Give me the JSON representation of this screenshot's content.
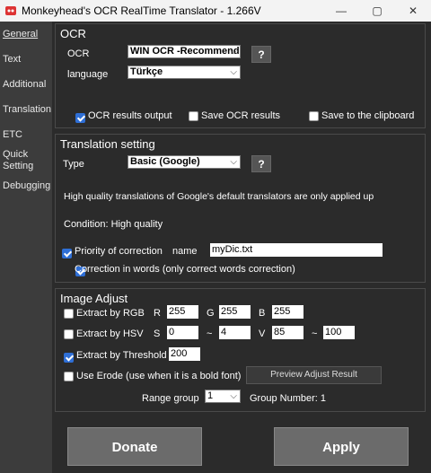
{
  "window": {
    "title": "Monkeyhead's OCR RealTime Translator - 1.266V",
    "minimize": "—",
    "maximize": "▢",
    "close": "✕"
  },
  "sidebar": {
    "items": [
      {
        "label": "General"
      },
      {
        "label": "Text"
      },
      {
        "label": "Additional"
      },
      {
        "label": "Translation"
      },
      {
        "label": "ETC"
      },
      {
        "label": "Quick Setting"
      },
      {
        "label": "Debugging"
      }
    ]
  },
  "ocr": {
    "heading": "OCR",
    "ocr_label": "OCR",
    "ocr_value": "WIN OCR -Recommend",
    "language_label": "language",
    "language_value": "Türkçe",
    "help": "?",
    "results_output": "OCR results output",
    "save_results": "Save OCR results",
    "save_clipboard": "Save to the clipboard"
  },
  "translation": {
    "heading": "Translation setting",
    "type_label": "Type",
    "type_value": "Basic (Google)",
    "help": "?",
    "info": "High quality translations of Google's default translators are only applied up",
    "condition": "Condition: High quality",
    "priority_label": "Priority of correction",
    "name_label": "name",
    "name_value": "myDic.txt",
    "words_label": "Correction in words (only correct words correction)"
  },
  "image": {
    "heading": "Image Adjust",
    "rgb_label": "Extract by RGB",
    "r_label": "R",
    "r_value": "255",
    "g_label": "G",
    "g_value": "255",
    "b_label": "B",
    "b_value": "255",
    "hsv_label": "Extract by HSV",
    "s_label": "S",
    "s_min": "0",
    "tilde": "~",
    "s_max": "4",
    "v_label": "V",
    "v_min": "85",
    "v_max": "100",
    "threshold_label": "Extract by Threshold",
    "threshold_value": "200",
    "erode_label": "Use Erode (use when it is a bold font)",
    "preview_button": "Preview Adjust Result",
    "range_label": "Range group",
    "range_value": "1",
    "group_number": "Group Number:  1"
  },
  "buttons": {
    "donate": "Donate",
    "apply": "Apply"
  },
  "checkboxes": {
    "results_output": true,
    "save_results": false,
    "save_clipboard": false,
    "priority": true,
    "words": true,
    "rgb": false,
    "hsv": false,
    "threshold": true,
    "erode": false
  },
  "colors": {
    "accent": "#2f6fd6",
    "background": "#2b2b2b",
    "sidebar": "#3c3c3c",
    "button": "#6b6b6b"
  }
}
